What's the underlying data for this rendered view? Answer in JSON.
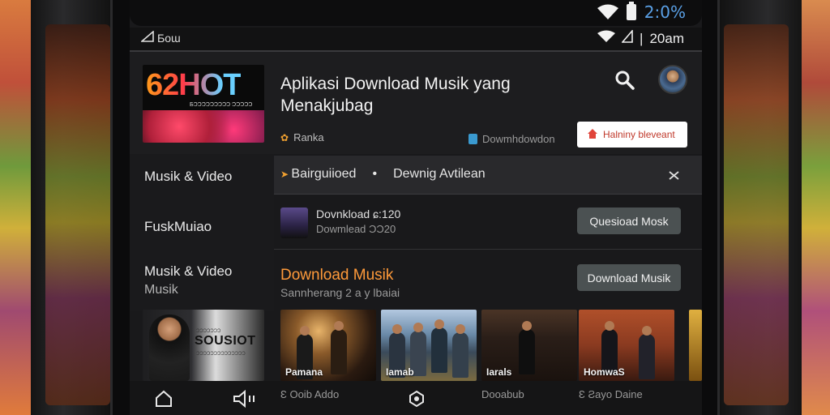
{
  "status_bar": {
    "time": "2:0%",
    "time2": "20am"
  },
  "secondary_bar": {
    "left_label": "Ƃoɯ"
  },
  "header": {
    "logo_text": "62HOT",
    "logo_sub": "ƂƆƆƆƆƆƆƆƆƆ ƆƆƆƆƆ",
    "title": "Aplikasi Download Musik yang Menakjubag",
    "rank_label": "Ranka",
    "download_info": "Dowmhdowdon",
    "primary_button": "Halniny bleveant"
  },
  "nav": {
    "items": [
      {
        "label": "Musik & Video"
      },
      {
        "label": "FuskMuiao"
      },
      {
        "label": "Musik & Video",
        "sub": "Musik"
      }
    ]
  },
  "notice": {
    "left": "Bairguiioed",
    "right": "Dewnig Avtilean"
  },
  "download_row": {
    "line1": "Dovnkload ɕ:120",
    "line2": "Dowmlead ƆƆ20",
    "button": "Quesioad Mosk"
  },
  "section": {
    "title": "Download Musik",
    "subtitle": "Sannherang 2 a y lbaiai",
    "button": "Download Musik"
  },
  "featured": {
    "brand": "SOUSIOT",
    "brand_small_top": "ƆƆƆƆƆƆƆ",
    "brand_small_bottom": "ƆƆƆƆƆƆƆƆƆƆƆƆƆƆ"
  },
  "cards": [
    {
      "caption": "Pamana"
    },
    {
      "caption": "Ɩamab"
    },
    {
      "caption": "Ɩarals"
    },
    {
      "caption": "HomwaS"
    }
  ],
  "bottom_nav": {
    "text1": "Ɛ Ooib Addo",
    "text2": "Dooabub",
    "text3": "Ɛ Ƨayo Daine"
  },
  "colors": {
    "accent": "#ff9a3a",
    "background": "#19191b",
    "button": "#4b5152",
    "status_time": "#5aa0e6"
  }
}
